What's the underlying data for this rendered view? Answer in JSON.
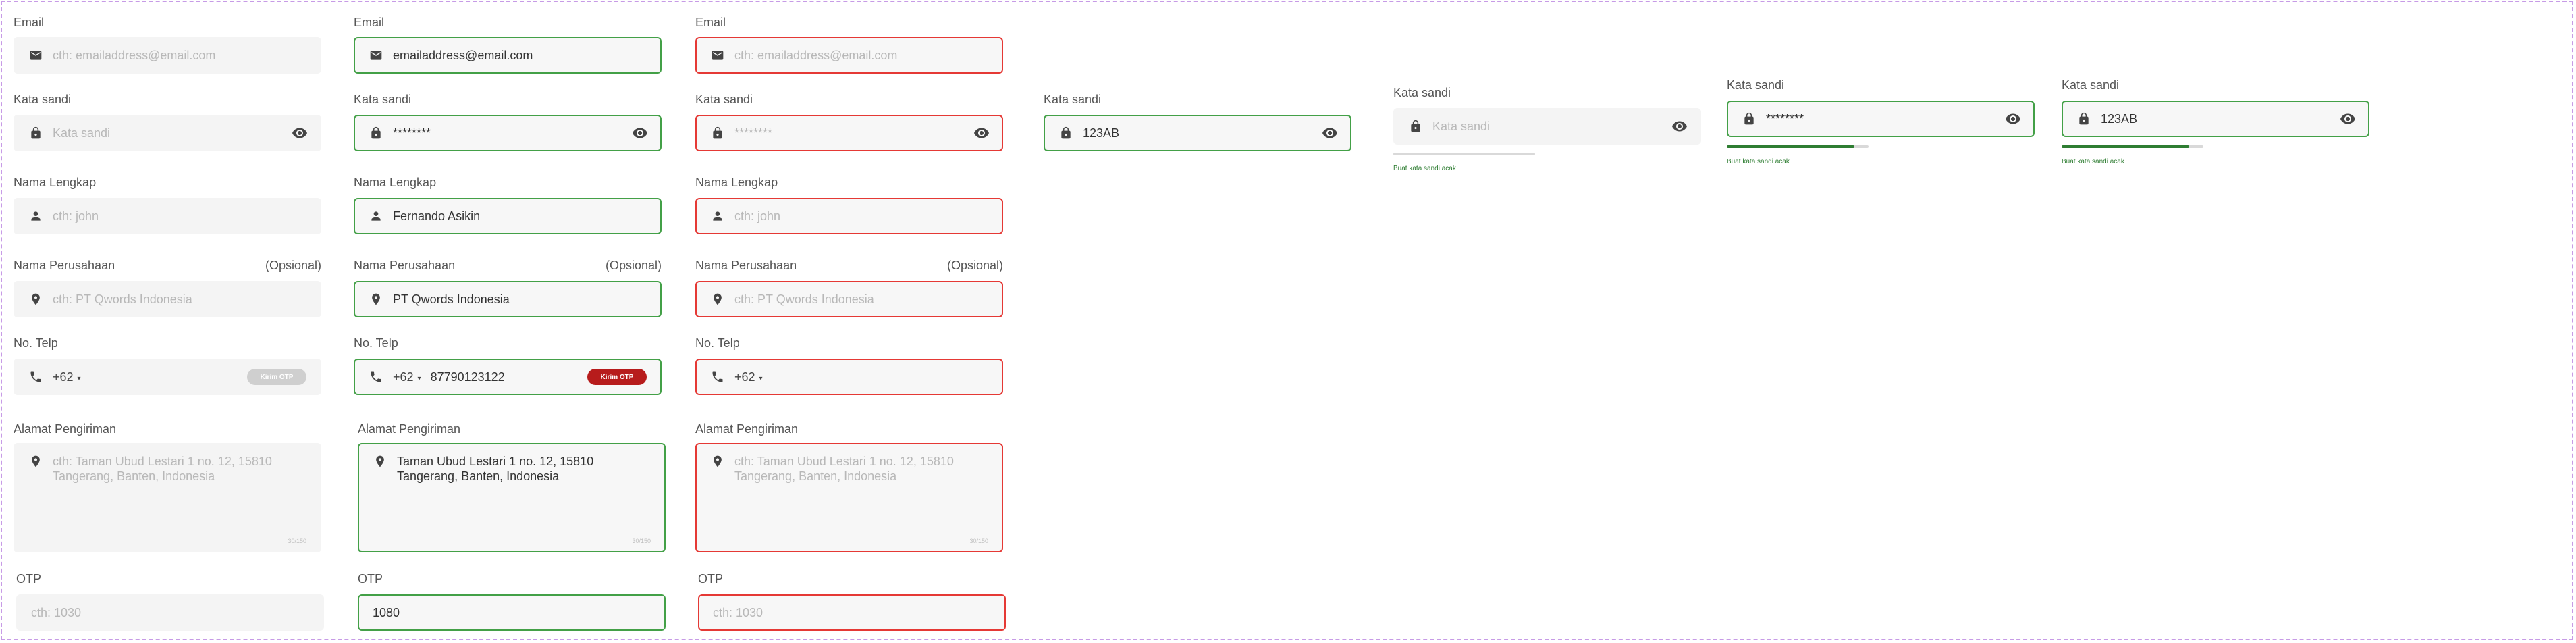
{
  "labels": {
    "email": "Email",
    "password": "Kata sandi",
    "full_name": "Nama Lengkap",
    "company": "Nama Perusahaan",
    "optional": "(Opsional)",
    "phone": "No. Telp",
    "address": "Alamat Pengiriman",
    "otp": "OTP"
  },
  "placeholders": {
    "email": "cth: emailaddress@email.com",
    "password": "Kata sandi",
    "full_name": "cth: john",
    "company": "cth: PT Qwords Indonesia",
    "address_line1": "cth: Taman Ubud Lestari 1 no. 12, 15810",
    "address_line2": "Tangerang, Banten, Indonesia",
    "otp": "cth: 1030",
    "password_masked": "********"
  },
  "values": {
    "email": "emailaddress@email.com",
    "password_masked": "********",
    "password_plain": "123AB",
    "full_name": "Fernando Asikin",
    "company": "PT Qwords Indonesia",
    "country_code": "+62",
    "phone": "87790123122",
    "address_line1": "Taman Ubud Lestari 1 no. 12, 15810",
    "address_line2": "Tangerang, Banten, Indonesia",
    "otp": "1080"
  },
  "otp_button": "Kirim OTP",
  "char_counter": "30/150",
  "password_strength": {
    "hint": "Buat kata sandi acak",
    "levels": [
      0.0,
      0.9,
      0.9
    ]
  },
  "icons": {
    "email": "mail-icon",
    "password": "lock-icon",
    "visibility": "eye-icon",
    "name": "user-icon",
    "location": "location-pin-icon",
    "phone": "phone-icon"
  },
  "colors": {
    "success": "#43a047",
    "error": "#e53935",
    "otp_active": "#b71c1c",
    "otp_disabled": "#cfcfcf",
    "strength": "#2e7d32"
  }
}
